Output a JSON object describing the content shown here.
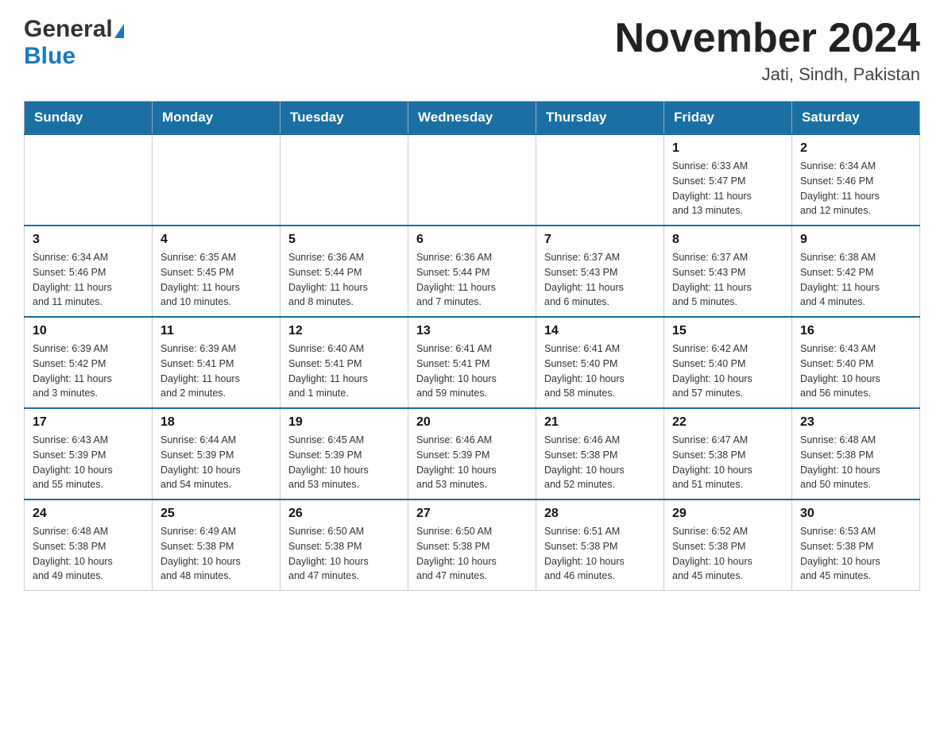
{
  "header": {
    "logo_general": "General",
    "logo_blue": "Blue",
    "month_title": "November 2024",
    "location": "Jati, Sindh, Pakistan"
  },
  "calendar": {
    "days_of_week": [
      "Sunday",
      "Monday",
      "Tuesday",
      "Wednesday",
      "Thursday",
      "Friday",
      "Saturday"
    ],
    "weeks": [
      [
        {
          "day": "",
          "info": ""
        },
        {
          "day": "",
          "info": ""
        },
        {
          "day": "",
          "info": ""
        },
        {
          "day": "",
          "info": ""
        },
        {
          "day": "",
          "info": ""
        },
        {
          "day": "1",
          "info": "Sunrise: 6:33 AM\nSunset: 5:47 PM\nDaylight: 11 hours\nand 13 minutes."
        },
        {
          "day": "2",
          "info": "Sunrise: 6:34 AM\nSunset: 5:46 PM\nDaylight: 11 hours\nand 12 minutes."
        }
      ],
      [
        {
          "day": "3",
          "info": "Sunrise: 6:34 AM\nSunset: 5:46 PM\nDaylight: 11 hours\nand 11 minutes."
        },
        {
          "day": "4",
          "info": "Sunrise: 6:35 AM\nSunset: 5:45 PM\nDaylight: 11 hours\nand 10 minutes."
        },
        {
          "day": "5",
          "info": "Sunrise: 6:36 AM\nSunset: 5:44 PM\nDaylight: 11 hours\nand 8 minutes."
        },
        {
          "day": "6",
          "info": "Sunrise: 6:36 AM\nSunset: 5:44 PM\nDaylight: 11 hours\nand 7 minutes."
        },
        {
          "day": "7",
          "info": "Sunrise: 6:37 AM\nSunset: 5:43 PM\nDaylight: 11 hours\nand 6 minutes."
        },
        {
          "day": "8",
          "info": "Sunrise: 6:37 AM\nSunset: 5:43 PM\nDaylight: 11 hours\nand 5 minutes."
        },
        {
          "day": "9",
          "info": "Sunrise: 6:38 AM\nSunset: 5:42 PM\nDaylight: 11 hours\nand 4 minutes."
        }
      ],
      [
        {
          "day": "10",
          "info": "Sunrise: 6:39 AM\nSunset: 5:42 PM\nDaylight: 11 hours\nand 3 minutes."
        },
        {
          "day": "11",
          "info": "Sunrise: 6:39 AM\nSunset: 5:41 PM\nDaylight: 11 hours\nand 2 minutes."
        },
        {
          "day": "12",
          "info": "Sunrise: 6:40 AM\nSunset: 5:41 PM\nDaylight: 11 hours\nand 1 minute."
        },
        {
          "day": "13",
          "info": "Sunrise: 6:41 AM\nSunset: 5:41 PM\nDaylight: 10 hours\nand 59 minutes."
        },
        {
          "day": "14",
          "info": "Sunrise: 6:41 AM\nSunset: 5:40 PM\nDaylight: 10 hours\nand 58 minutes."
        },
        {
          "day": "15",
          "info": "Sunrise: 6:42 AM\nSunset: 5:40 PM\nDaylight: 10 hours\nand 57 minutes."
        },
        {
          "day": "16",
          "info": "Sunrise: 6:43 AM\nSunset: 5:40 PM\nDaylight: 10 hours\nand 56 minutes."
        }
      ],
      [
        {
          "day": "17",
          "info": "Sunrise: 6:43 AM\nSunset: 5:39 PM\nDaylight: 10 hours\nand 55 minutes."
        },
        {
          "day": "18",
          "info": "Sunrise: 6:44 AM\nSunset: 5:39 PM\nDaylight: 10 hours\nand 54 minutes."
        },
        {
          "day": "19",
          "info": "Sunrise: 6:45 AM\nSunset: 5:39 PM\nDaylight: 10 hours\nand 53 minutes."
        },
        {
          "day": "20",
          "info": "Sunrise: 6:46 AM\nSunset: 5:39 PM\nDaylight: 10 hours\nand 53 minutes."
        },
        {
          "day": "21",
          "info": "Sunrise: 6:46 AM\nSunset: 5:38 PM\nDaylight: 10 hours\nand 52 minutes."
        },
        {
          "day": "22",
          "info": "Sunrise: 6:47 AM\nSunset: 5:38 PM\nDaylight: 10 hours\nand 51 minutes."
        },
        {
          "day": "23",
          "info": "Sunrise: 6:48 AM\nSunset: 5:38 PM\nDaylight: 10 hours\nand 50 minutes."
        }
      ],
      [
        {
          "day": "24",
          "info": "Sunrise: 6:48 AM\nSunset: 5:38 PM\nDaylight: 10 hours\nand 49 minutes."
        },
        {
          "day": "25",
          "info": "Sunrise: 6:49 AM\nSunset: 5:38 PM\nDaylight: 10 hours\nand 48 minutes."
        },
        {
          "day": "26",
          "info": "Sunrise: 6:50 AM\nSunset: 5:38 PM\nDaylight: 10 hours\nand 47 minutes."
        },
        {
          "day": "27",
          "info": "Sunrise: 6:50 AM\nSunset: 5:38 PM\nDaylight: 10 hours\nand 47 minutes."
        },
        {
          "day": "28",
          "info": "Sunrise: 6:51 AM\nSunset: 5:38 PM\nDaylight: 10 hours\nand 46 minutes."
        },
        {
          "day": "29",
          "info": "Sunrise: 6:52 AM\nSunset: 5:38 PM\nDaylight: 10 hours\nand 45 minutes."
        },
        {
          "day": "30",
          "info": "Sunrise: 6:53 AM\nSunset: 5:38 PM\nDaylight: 10 hours\nand 45 minutes."
        }
      ]
    ]
  }
}
